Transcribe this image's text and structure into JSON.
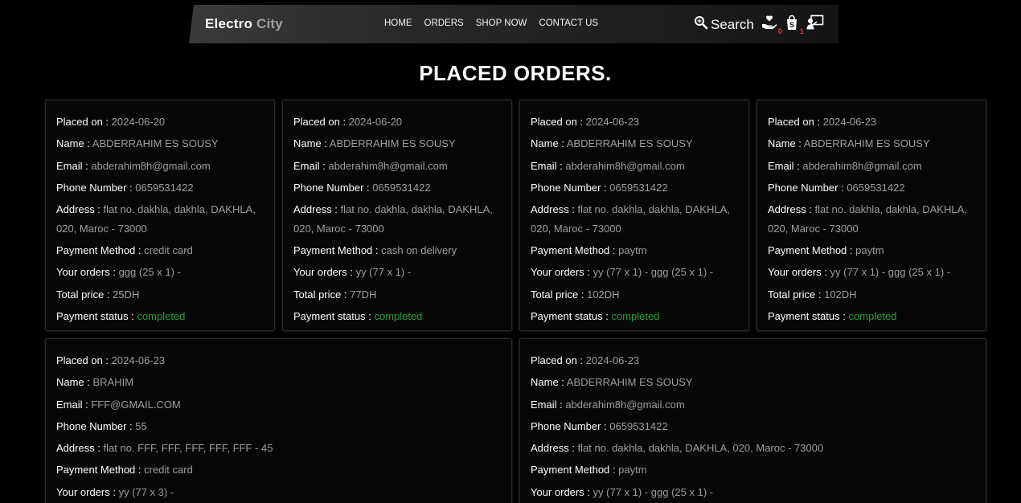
{
  "brand": {
    "name": "Electro",
    "accent": "City"
  },
  "nav": [
    {
      "label": "HOME"
    },
    {
      "label": "ORDERS"
    },
    {
      "label": "SHOP NOW"
    },
    {
      "label": "CONTACT US"
    }
  ],
  "header_icons": {
    "search_label": "Search",
    "wishlist_count": "0",
    "cart_count": "1"
  },
  "page_title": "PLACED ORDERS.",
  "labels": {
    "placed_on": "Placed on : ",
    "name": "Name : ",
    "email": "Email : ",
    "phone": "Phone Number : ",
    "address": "Address : ",
    "payment_method": "Payment Method : ",
    "your_orders": "Your orders : ",
    "total_price": "Total price : ",
    "payment_status": "Payment status : "
  },
  "orders": [
    {
      "placed_on": "2024-06-20",
      "name": "ABDERRAHIM ES SOUSY",
      "email": "abderahim8h@gmail.com",
      "phone": "0659531422",
      "address": "flat no. dakhla, dakhla, DAKHLA, 020, Maroc - 73000",
      "payment_method": "credit card",
      "your_orders": "ggg (25 x 1) -",
      "total_price": "25DH",
      "payment_status": "completed"
    },
    {
      "placed_on": "2024-06-20",
      "name": "ABDERRAHIM ES SOUSY",
      "email": "abderahim8h@gmail.com",
      "phone": "0659531422",
      "address": "flat no. dakhla, dakhla, DAKHLA, 020, Maroc - 73000",
      "payment_method": "cash on delivery",
      "your_orders": "yy (77 x 1) -",
      "total_price": "77DH",
      "payment_status": "completed"
    },
    {
      "placed_on": "2024-06-23",
      "name": "ABDERRAHIM ES SOUSY",
      "email": "abderahim8h@gmail.com",
      "phone": "0659531422",
      "address": "flat no. dakhla, dakhla, DAKHLA, 020, Maroc - 73000",
      "payment_method": "paytm",
      "your_orders": "yy (77 x 1) - ggg (25 x 1) -",
      "total_price": "102DH",
      "payment_status": "completed"
    },
    {
      "placed_on": "2024-06-23",
      "name": "ABDERRAHIM ES SOUSY",
      "email": "abderahim8h@gmail.com",
      "phone": "0659531422",
      "address": "flat no. dakhla, dakhla, DAKHLA, 020, Maroc - 73000",
      "payment_method": "paytm",
      "your_orders": "yy (77 x 1) - ggg (25 x 1) -",
      "total_price": "102DH",
      "payment_status": "completed"
    },
    {
      "placed_on": "2024-06-23",
      "name": "BRAHIM",
      "email": "FFF@GMAIL.COM",
      "phone": "55",
      "address": "flat no. FFF, FFF, FFF, FFF, FFF - 45",
      "payment_method": "credit card",
      "your_orders": "yy (77 x 3) -"
    },
    {
      "placed_on": "2024-06-23",
      "name": "ABDERRAHIM ES SOUSY",
      "email": "abderahim8h@gmail.com",
      "phone": "0659531422",
      "address": "flat no. dakhla, dakhla, DAKHLA, 020, Maroc - 73000",
      "payment_method": "paytm",
      "your_orders": "yy (77 x 1) - ggg (25 x 1) -"
    }
  ],
  "colors": {
    "status_completed": "#2e9e3a",
    "badge": "#e53935",
    "value_text": "#9e9e9e"
  }
}
